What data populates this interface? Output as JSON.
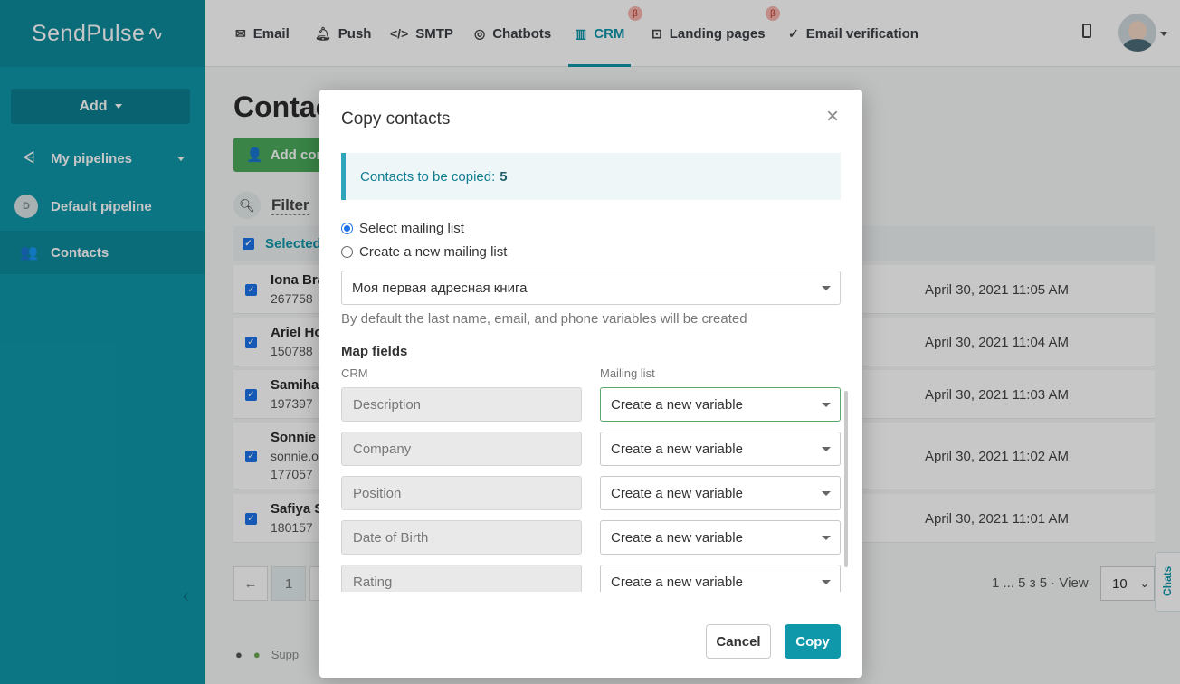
{
  "brand": {
    "name": "SendPulse",
    "accent": "#0f97aa"
  },
  "sidebar": {
    "add_label": "Add",
    "items": [
      {
        "label": "My pipelines",
        "icon": "pipeline-icon"
      },
      {
        "label": "Default pipeline",
        "badge": "D"
      },
      {
        "label": "Contacts",
        "icon": "contacts-icon"
      }
    ],
    "footer_text": "Supp"
  },
  "topnav": {
    "items": [
      {
        "label": "Email",
        "icon": "email-icon"
      },
      {
        "label": "Push",
        "icon": "bell-icon"
      },
      {
        "label": "SMTP",
        "icon": "code-icon"
      },
      {
        "label": "Chatbots",
        "icon": "chatbot-icon"
      },
      {
        "label": "CRM",
        "icon": "crm-icon",
        "beta": "β"
      },
      {
        "label": "Landing pages",
        "icon": "landing-icon",
        "beta": "β"
      },
      {
        "label": "Email verification",
        "icon": "verify-icon"
      }
    ]
  },
  "page": {
    "title": "Contac",
    "add_contact": "Add cont",
    "filter": "Filter",
    "selected": "Selected",
    "rows": [
      {
        "name": "Iona Bra",
        "sub": "267758",
        "date": "April 30, 2021 11:05 AM"
      },
      {
        "name": "Ariel Ho",
        "sub": "150788",
        "date": "April 30, 2021 11:04 AM"
      },
      {
        "name": "Samiha",
        "sub": "197397",
        "date": "April 30, 2021 11:03 AM"
      },
      {
        "name": "Sonnie C",
        "sub": "sonnie.o",
        "sub2": "177057",
        "date": "April 30, 2021 11:02 AM"
      },
      {
        "name": "Safiya S",
        "sub": "180157",
        "date": "April 30, 2021 11:01 AM"
      }
    ],
    "pager_prev": "←",
    "pager_current": "1",
    "pagination_info": "1 ... 5 з 5",
    "view_label": "View",
    "view_value": "10",
    "chats": "Chats"
  },
  "modal": {
    "title": "Copy contacts",
    "close": "×",
    "contacts_label": "Contacts to be copied:",
    "contacts_count": "5",
    "radio_select": "Select mailing list",
    "radio_create": "Create a new mailing list",
    "mailing_list_value": "Моя первая адресная книга",
    "hint": "By default the last name, email, and phone variables will be created",
    "map_fields_title": "Map fields",
    "crm_col": "CRM",
    "mailing_col": "Mailing list",
    "mappings": [
      {
        "crm": "Description",
        "target": "Create a new variable"
      },
      {
        "crm": "Company",
        "target": "Create a new variable"
      },
      {
        "crm": "Position",
        "target": "Create a new variable"
      },
      {
        "crm": "Date of Birth",
        "target": "Create a new variable"
      },
      {
        "crm": "Rating",
        "target": "Create a new variable"
      }
    ],
    "cancel": "Cancel",
    "copy": "Copy"
  }
}
